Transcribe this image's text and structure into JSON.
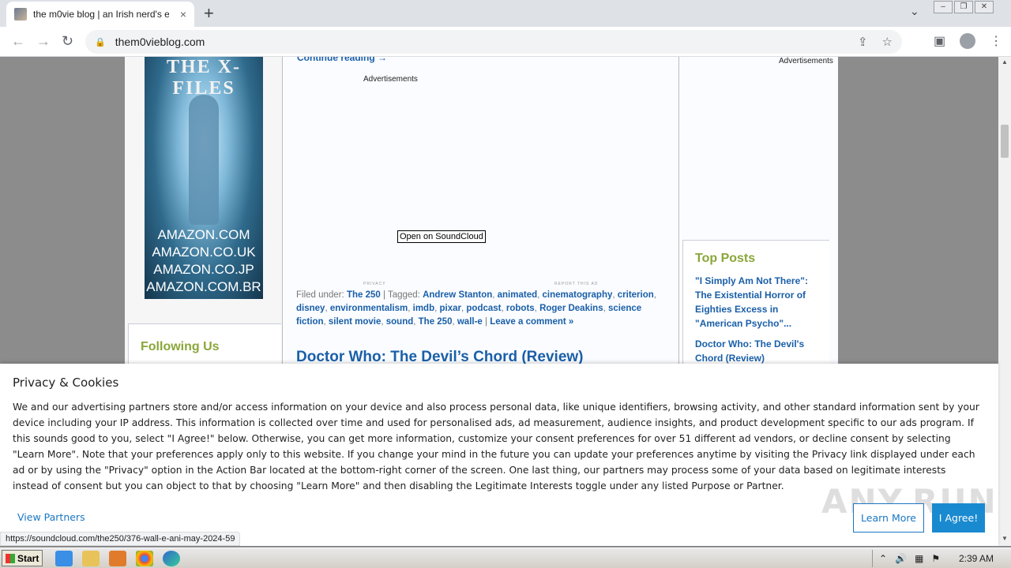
{
  "browser": {
    "tab_title": "the m0vie blog | an Irish nerd's eye",
    "tab_close": "×",
    "new_tab": "+",
    "tab_search": "⌄",
    "url": "them0vieblog.com",
    "status_url": "https://soundcloud.com/the250/376-wall-e-ani-may-2024-59"
  },
  "page": {
    "left": {
      "book_title": "THE X-FILES",
      "stores": [
        "AMAZON.COM",
        "AMAZON.CO.UK",
        "AMAZON.CO.JP",
        "AMAZON.COM.BR"
      ],
      "following_heading": "Following Us"
    },
    "main": {
      "continue_reading": "Continue reading →",
      "ads_label": "Advertisements",
      "soundcloud_button": "Open on SoundCloud",
      "privacy_tiny": "PRIVACY",
      "report_tiny": "REPORT THIS AD",
      "filed_under_label": "Filed under:",
      "category": "The 250",
      "tagged_label": "| Tagged:",
      "tags": [
        "Andrew Stanton",
        "animated",
        "cinematography",
        "criterion",
        "disney",
        "environmentalism",
        "imdb",
        "pixar",
        "podcast",
        "robots",
        "Roger Deakins",
        "science fiction",
        "silent movie",
        "sound",
        "The 250",
        "wall-e"
      ],
      "leave_comment": "Leave a comment »",
      "next_post_title": "Doctor Who: The Devil’s Chord (Review)"
    },
    "right": {
      "ads_label": "Advertisements",
      "top_posts_heading": "Top Posts",
      "top_posts": [
        "\"I Simply Am Not There\": The Existential Horror of Eighties Excess in \"American Psycho\"...",
        "Doctor Who: The Devil's Chord (Review)"
      ]
    }
  },
  "privacy": {
    "heading": "Privacy & Cookies",
    "body": "We and our advertising partners store and/or access information on your device and also process personal data, like unique identifiers, browsing activity, and other standard information sent by your device including your IP address. This information is collected over time and used for personalised ads, ad measurement, audience insights, and product development specific to our ads program. If this sounds good to you, select \"I Agree!\" below. Otherwise, you can get more information, customize your consent preferences for over 51 different ad vendors, or decline consent by selecting \"Learn More\". Note that your preferences apply only to this website. If you change your mind in the future you can update your preferences anytime by visiting the Privacy link displayed under each ad or by using the \"Privacy\" option in the Action Bar located at the bottom-right corner of the screen. One last thing, our partners may process some of your data based on legitimate interests instead of consent but you can object to that by choosing \"Learn More\" and then disabling the Legitimate Interests toggle under any listed Purpose or Partner.",
    "view_partners": "View Partners",
    "learn_more": "Learn More",
    "agree": "I Agree!",
    "watermark": "ANY.RUN"
  },
  "taskbar": {
    "start": "Start",
    "clock": "2:39 AM"
  }
}
